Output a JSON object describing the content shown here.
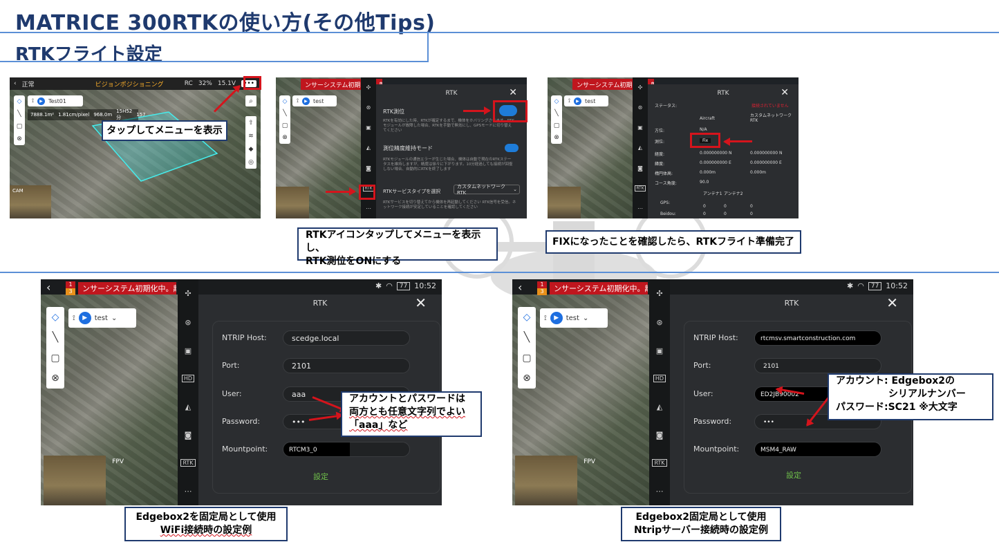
{
  "slide": {
    "title": "MATRICE 300RTKの使い方(その他Tips)",
    "subtitle": "RTKフライト設定",
    "accent": "#1f3a6e",
    "line_color": "#5b8fd6",
    "arrow_color": "#d5141c"
  },
  "shot1": {
    "top_left": "正常",
    "top_center": "ビジョンポジショニング",
    "top_rtk": "RC",
    "battery": "32%",
    "voltage": "15.1V",
    "mission": "Test01",
    "stat_area": "7888.1m²",
    "stat_gsd": "1.81cm/pixel",
    "stat_dist": "968.0m",
    "stat_time": "15H52分",
    "stat_photos": "157",
    "cam_label": "CAM",
    "callout": "タップしてメニューを表示"
  },
  "shot2": {
    "redbar": "ンサーシステム初期化中。離陸で",
    "panel_title": "RTK",
    "rtk_pos_label": "RTK測位",
    "rtk_desc": "RTKを有効にした時、RTKが確定するまで、機体をホバリングさせます。RTKモジュールが故障した場合、RTKを手動で無効にし、GPSモードに切り替えてください",
    "hold_label": "測位精度維持モード",
    "hold_desc": "RTKモジュールの通信エラーが生じた場合、機体は自動で現在のRTKステータスを維持しますが、精度は徐々に下がります。10分経過しても接続が回復しない場合、自動的にRTKを終了します",
    "service_label": "RTKサービスタイプを選択",
    "service_value": "カスタムネットワークRTK",
    "service_desc": "RTKサービスを切り替えてから機体を再起動してください RTK信号を受信。ネットワーク接続が安定していることを確認してください",
    "mode": "test",
    "rtk_icon": "RTK",
    "callout_line1": "RTKアイコンタップしてメニューを表示し、",
    "callout_line2": "RTK測位をONにする"
  },
  "shot3": {
    "redbar": "ンサーシステム初期化中。離陸で",
    "panel_title": "RTK",
    "status_label": "ステータス:",
    "status_value": "接続されていません",
    "col_aircraft": "Aircraft",
    "col_custom": "カスタムネットワークRTK",
    "rows": [
      {
        "label": "方位:",
        "a": "N/A",
        "b": ""
      },
      {
        "label": "測位:",
        "a": "Fix",
        "b": ""
      },
      {
        "label": "経度:",
        "a": "0.000000000 N",
        "b": "0.000000000 N"
      },
      {
        "label": "緯度:",
        "a": "0.000000000 E",
        "b": "0.000000000 E"
      },
      {
        "label": "楕円体高:",
        "a": "0.000m",
        "b": "0.000m"
      },
      {
        "label": "コース角度:",
        "a": "90.0",
        "b": ""
      }
    ],
    "ant_a1": "アンテナ1",
    "ant_a2": "アンテナ2",
    "gps_label": "GPS:",
    "beidou_label": "Beidou:",
    "gps_vals": [
      "0",
      "0",
      "0"
    ],
    "beidou_vals": [
      "0",
      "0",
      "0"
    ],
    "mode": "test",
    "rtk_icon": "RTK",
    "callout": "FIXになったことを確認したら、RTKフライト準備完了"
  },
  "shot4": {
    "redbar": "ンサーシステム初期化中。離陸で",
    "warn_top": "1",
    "warn_bottom": "3",
    "battery": "77",
    "time": "10:52",
    "panel_title": "RTK",
    "mode": "test",
    "fpv": "FPV",
    "hd": "HD",
    "rtk_icon": "RTK",
    "fields": [
      {
        "label": "NTRIP Host:",
        "value": "scedge.local"
      },
      {
        "label": "Port:",
        "value": "2101"
      },
      {
        "label": "User:",
        "value": "aaa"
      },
      {
        "label": "Password:",
        "value": "•••"
      },
      {
        "label": "Mountpoint:",
        "value": "RTCM3_0"
      }
    ],
    "submit": "設定",
    "note_line1": "アカウントとパスワードは",
    "note_line2": "両方とも任意文字列でよい",
    "note_line3": "「aaa」など",
    "caption_line1": "Edgebox2を固定局として使用",
    "caption_line2": "WiFi接続時の設定例"
  },
  "shot5": {
    "redbar": "ンサーシステム初期化中。離陸で",
    "warn_top": "1",
    "warn_bottom": "3",
    "battery": "77",
    "time": "10:52",
    "panel_title": "RTK",
    "mode": "test",
    "fpv": "FPV",
    "hd": "HD",
    "rtk_icon": "RTK",
    "fields": [
      {
        "label": "NTRIP Host:",
        "value": "rtcmsv.smartconstruction.com"
      },
      {
        "label": "Port:",
        "value": "2101"
      },
      {
        "label": "User:",
        "value": "ED2JB90002"
      },
      {
        "label": "Password:",
        "value": "•••"
      },
      {
        "label": "Mountpoint:",
        "value": "MSM4_RAW"
      }
    ],
    "submit": "設定",
    "note_line1": "アカウント: Edgebox2の",
    "note_line2": "シリアルナンバー",
    "note_line3": "パスワード:SC21 ※大文字",
    "caption_line1": "Edgebox2固定局として使用",
    "caption_line2": "Ntripサーバー接続時の設定例"
  }
}
